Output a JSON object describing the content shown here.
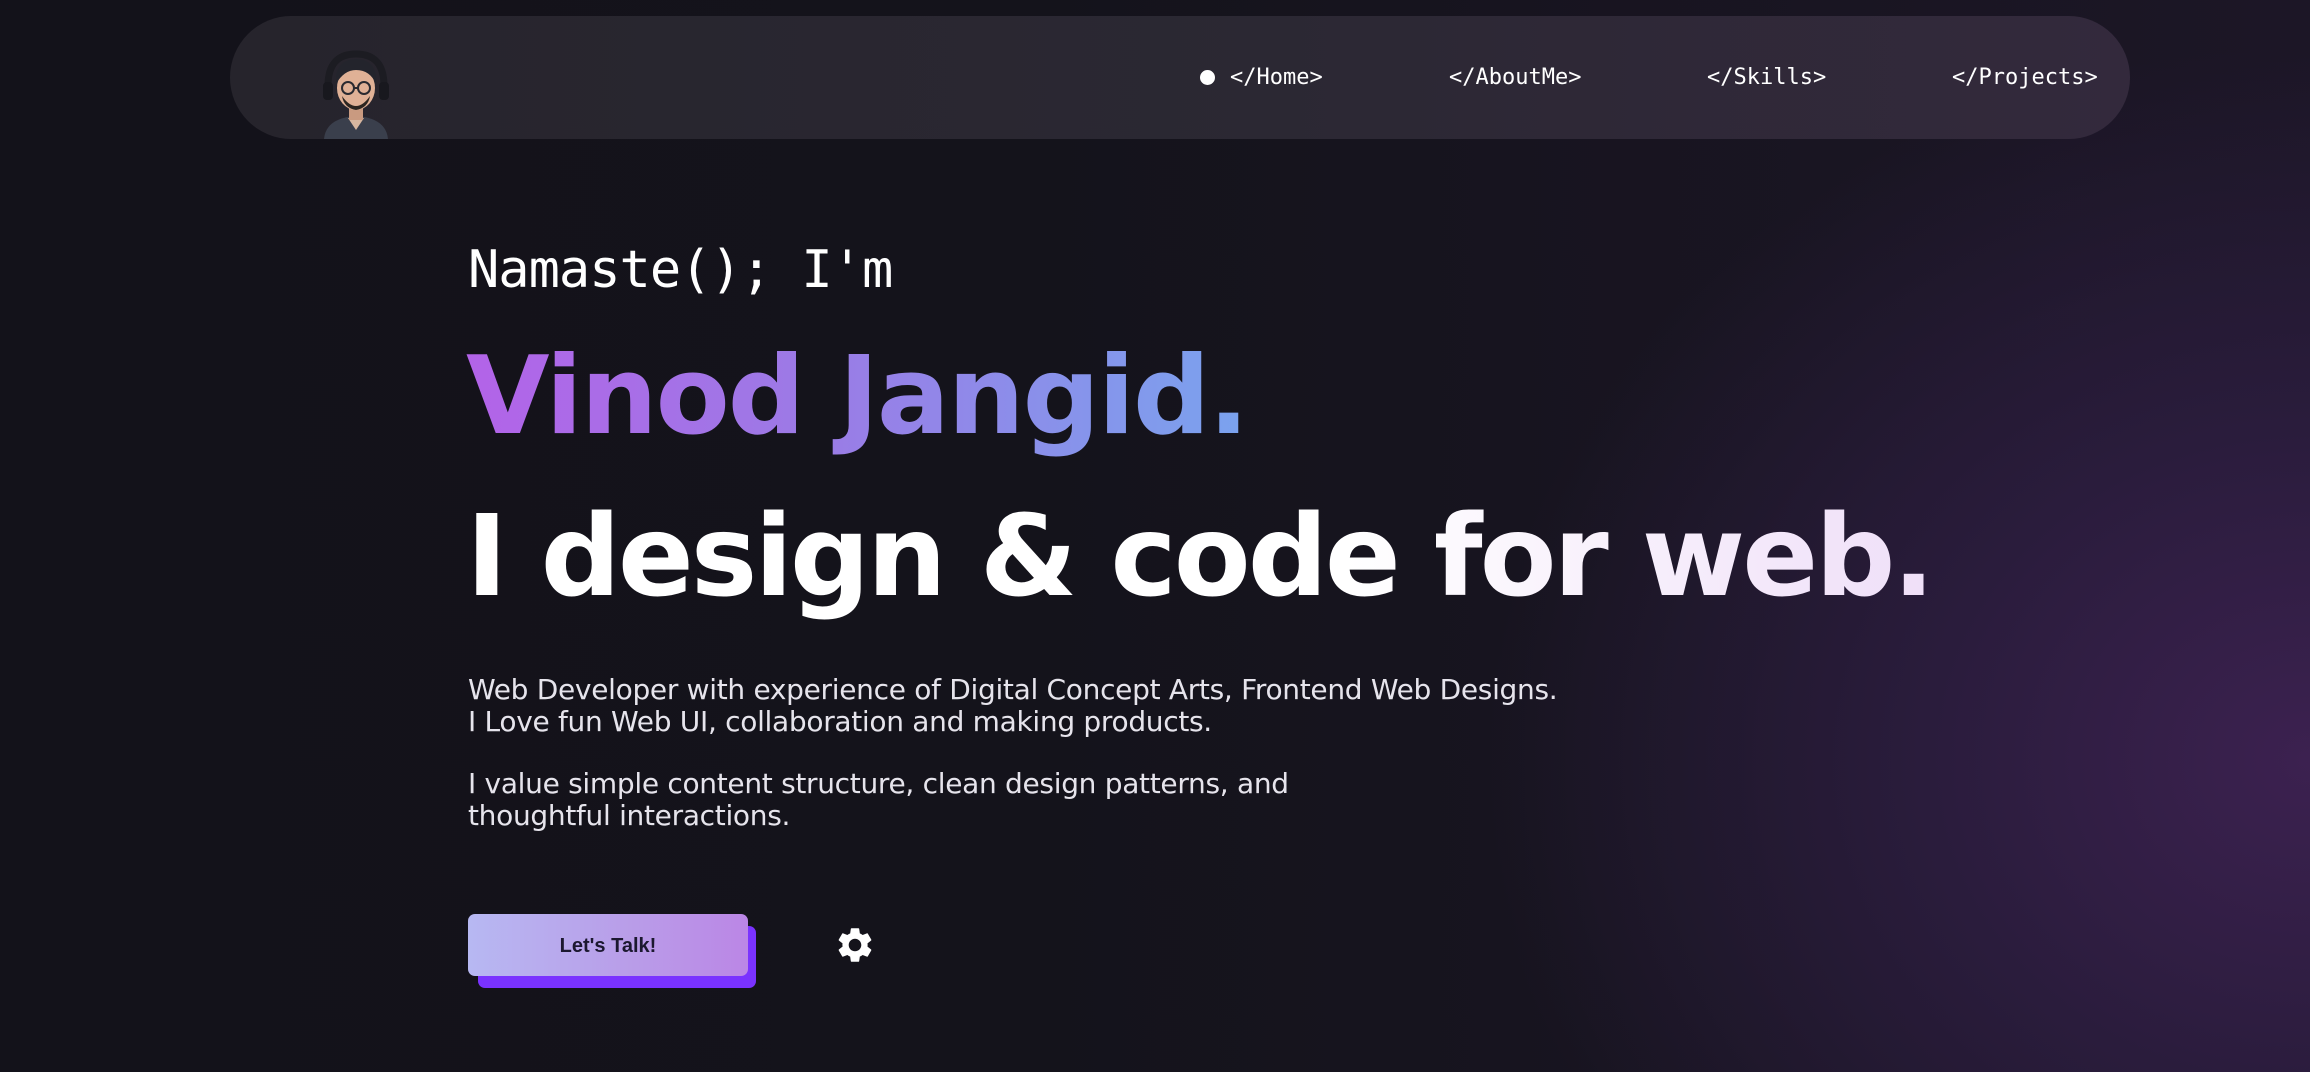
{
  "nav": {
    "items": [
      {
        "label": "</Home>"
      },
      {
        "label": "</AboutMe>"
      },
      {
        "label": "</Skills>"
      },
      {
        "label": "</Projects>"
      }
    ],
    "active_index": 0
  },
  "hero": {
    "greeting": "Namaste(); I'm",
    "name": "Vinod Jangid.",
    "tagline": "I design & code for web.",
    "paragraphs": [
      "Web Developer with experience of Digital Concept Arts, Frontend Web Designs. I Love fun Web UI, collaboration and making products.",
      "I value simple content structure, clean design patterns, and thoughtful interactions."
    ],
    "cta_label": "Let's Talk!"
  },
  "icons": {
    "avatar": "avatar-icon",
    "settings": "gear-icon"
  },
  "colors": {
    "background": "#14131b",
    "navbar": "#2b2833",
    "name_gradient_start": "#b363e8",
    "name_gradient_end": "#7aa3ee",
    "cta_shadow": "#7a32ff",
    "cta_gradient_start": "#b7b8f2",
    "cta_gradient_end": "#bb86e6"
  }
}
